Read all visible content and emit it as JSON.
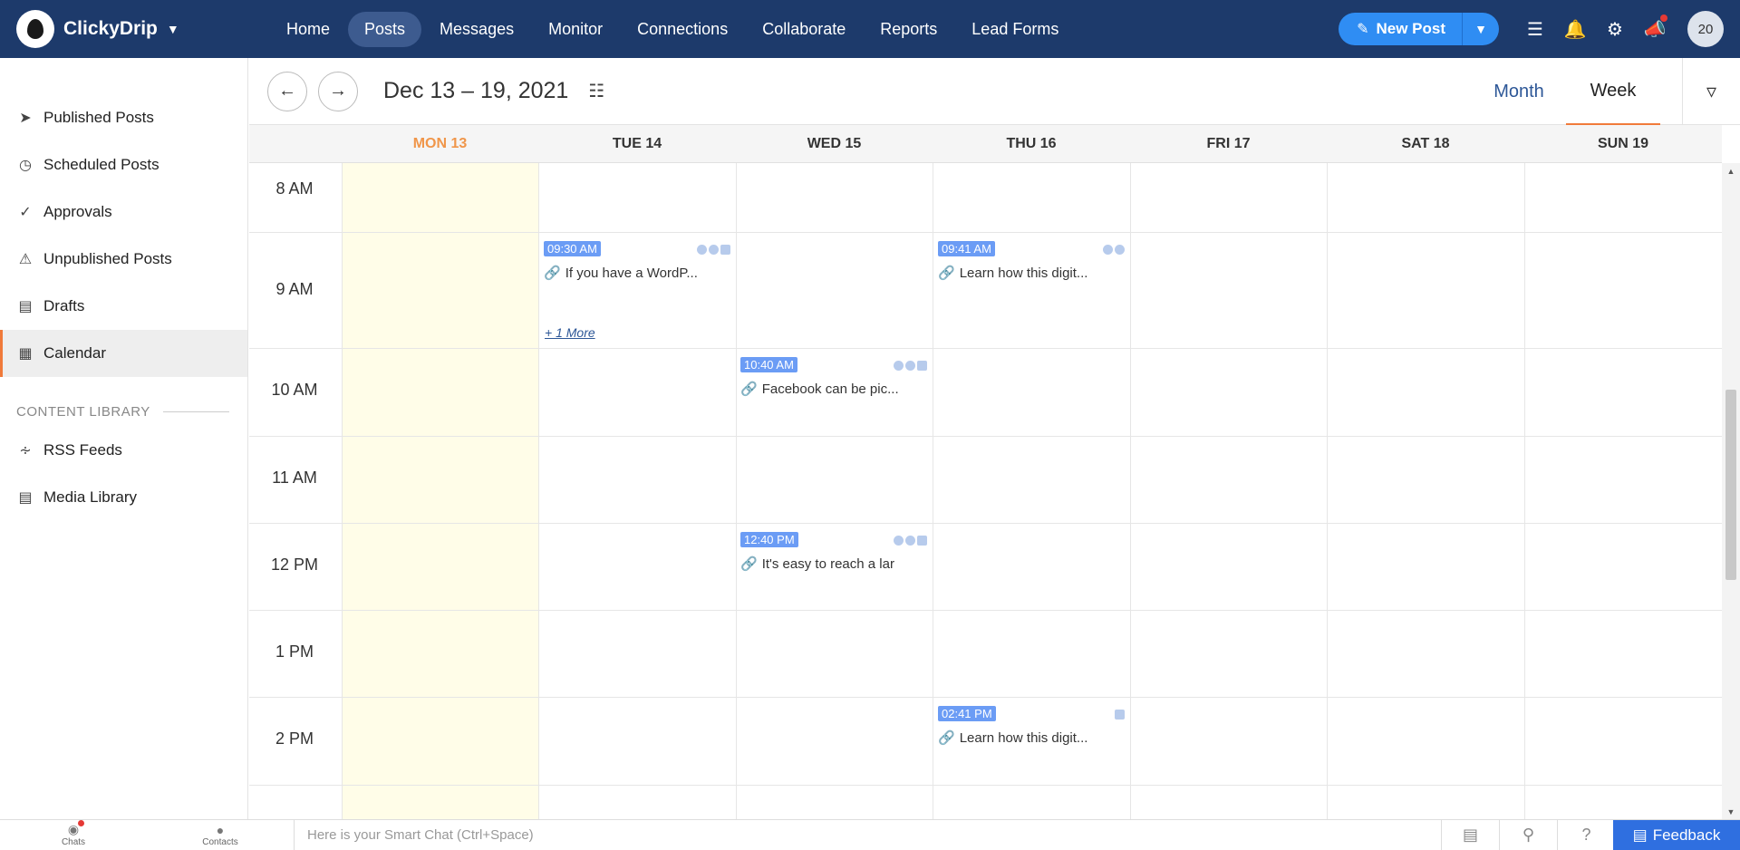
{
  "app": {
    "brand": "ClickyDrip",
    "nav": [
      "Home",
      "Posts",
      "Messages",
      "Monitor",
      "Connections",
      "Collaborate",
      "Reports",
      "Lead Forms"
    ],
    "active_nav": "Posts",
    "new_post_label": "New Post",
    "avatar_label": "20"
  },
  "sidebar": {
    "items": [
      {
        "label": "Published Posts",
        "icon": "paper-plane-icon"
      },
      {
        "label": "Scheduled Posts",
        "icon": "clock-icon"
      },
      {
        "label": "Approvals",
        "icon": "check-circle-icon"
      },
      {
        "label": "Unpublished Posts",
        "icon": "warning-icon"
      },
      {
        "label": "Drafts",
        "icon": "inbox-icon"
      },
      {
        "label": "Calendar",
        "icon": "calendar-icon"
      }
    ],
    "active": "Calendar",
    "section_label": "CONTENT LIBRARY",
    "library": [
      {
        "label": "RSS Feeds",
        "icon": "rss-icon"
      },
      {
        "label": "Media Library",
        "icon": "media-icon"
      }
    ]
  },
  "calendar": {
    "range": "Dec 13 – 19, 2021",
    "views": [
      "Month",
      "Week"
    ],
    "active_view": "Week",
    "days": [
      "MON 13",
      "TUE 14",
      "WED 15",
      "THU 16",
      "FRI 17",
      "SAT 18",
      "SUN 19"
    ],
    "today": "MON 13",
    "hours": [
      "8 AM",
      "9 AM",
      "10 AM",
      "11 AM",
      "12 PM",
      "1 PM",
      "2 PM"
    ],
    "events": [
      {
        "time": "09:30 AM",
        "text": "If you have a WordP...",
        "day": "TUE 14"
      },
      {
        "time": "09:41 AM",
        "text": "Learn how this digit...",
        "day": "THU 16"
      },
      {
        "time": "10:40 AM",
        "text": "Facebook can be pic...",
        "day": "WED 15"
      },
      {
        "time": "12:40 PM",
        "text": "It's easy to reach a lar",
        "day": "WED 15"
      },
      {
        "time": "02:41 PM",
        "text": "Learn how this digit...",
        "day": "THU 16"
      }
    ],
    "more_label": "+ 1 More"
  },
  "bottom": {
    "chats": "Chats",
    "contacts": "Contacts",
    "smartchat_placeholder": "Here is your Smart Chat (Ctrl+Space)",
    "feedback": "Feedback"
  }
}
